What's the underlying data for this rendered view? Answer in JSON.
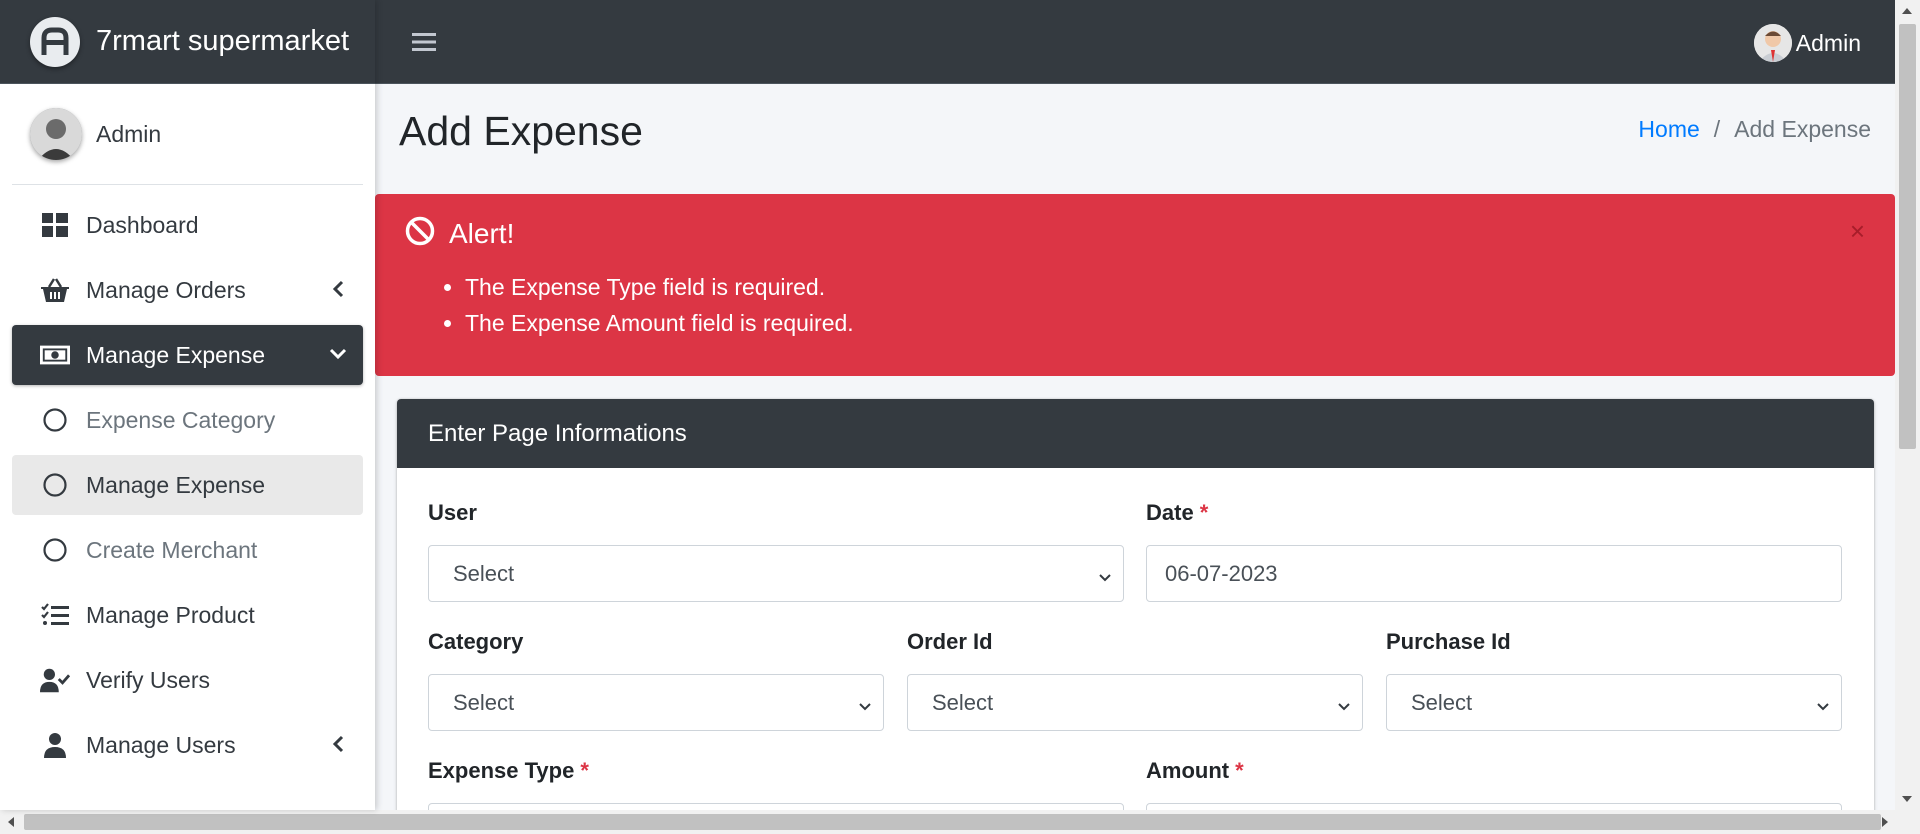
{
  "app": {
    "brand": "7rmart supermarket",
    "top_user": "Admin"
  },
  "sidebar": {
    "user_name": "Admin",
    "items": [
      {
        "label": "Dashboard",
        "icon": "dashboard-icon"
      },
      {
        "label": "Manage Orders",
        "icon": "basket-icon",
        "chevron": "left"
      },
      {
        "label": "Manage Expense",
        "icon": "money-bill-icon",
        "chevron": "down",
        "state": "active"
      },
      {
        "label": "Expense Category",
        "icon": "circle-icon",
        "sub": true
      },
      {
        "label": "Manage Expense",
        "icon": "circle-icon",
        "sub": true,
        "state": "selected"
      },
      {
        "label": "Create Merchant",
        "icon": "circle-icon",
        "sub": true
      },
      {
        "label": "Manage Product",
        "icon": "list-check-icon"
      },
      {
        "label": "Verify Users",
        "icon": "user-check-icon"
      },
      {
        "label": "Manage Users",
        "icon": "user-icon",
        "chevron": "left"
      }
    ]
  },
  "page": {
    "title": "Add Expense",
    "breadcrumb": {
      "home": "Home",
      "separator": "/",
      "current": "Add Expense"
    }
  },
  "alert": {
    "title": "Alert!",
    "close": "×",
    "messages": [
      "The Expense Type field is required.",
      "The Expense Amount field is required."
    ]
  },
  "form": {
    "header": "Enter Page Informations",
    "user": {
      "label": "User",
      "value": "Select"
    },
    "date": {
      "label": "Date",
      "required": "*",
      "value": "06-07-2023"
    },
    "category": {
      "label": "Category",
      "value": "Select"
    },
    "order_id": {
      "label": "Order Id",
      "value": "Select"
    },
    "purchase_id": {
      "label": "Purchase Id",
      "value": "Select"
    },
    "expense_type": {
      "label": "Expense Type",
      "required": "*"
    },
    "amount": {
      "label": "Amount",
      "required": "*"
    }
  },
  "colors": {
    "dark": "#343a40",
    "danger": "#dc3545",
    "link": "#007bff",
    "content_bg": "#f4f6f9"
  }
}
